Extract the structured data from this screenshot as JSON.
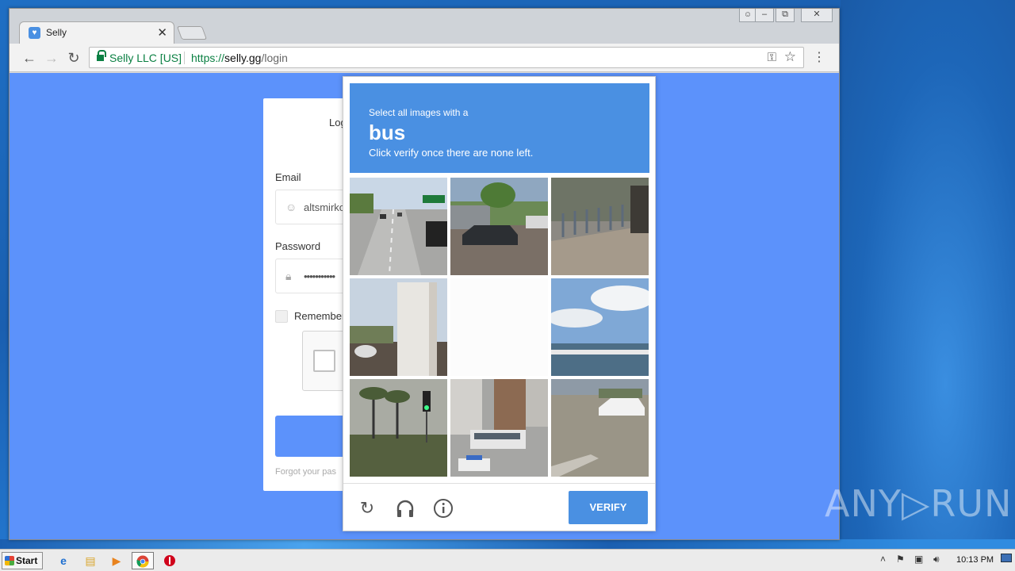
{
  "browser": {
    "tab_title": "Selly",
    "secure_label": "Selly LLC [US]",
    "url_scheme": "https://",
    "url_host": "selly.gg",
    "url_path": "/login"
  },
  "login": {
    "title": "Log",
    "email_label": "Email",
    "email_value": "altsmirko",
    "password_label": "Password",
    "password_value": "•••••••••••",
    "remember_label": "Remember",
    "forgot_text": "Forgot your pas"
  },
  "captcha": {
    "prompt": "Select all images with a",
    "target": "bus",
    "instruction": "Click verify once there are none left.",
    "verify_label": "VERIFY",
    "tiles": [
      "highway-cars",
      "street-parked-car",
      "bike-share-station",
      "building-roof",
      "blank-fading",
      "waterfront-boats",
      "traffic-light-palms",
      "city-bus-street",
      "parking-lot-car"
    ]
  },
  "watermark": "ANY▷RUN",
  "taskbar": {
    "start_label": "Start",
    "clock": "10:13 PM"
  },
  "colors": {
    "page_bg": "#5c92fb",
    "captcha_accent": "#4a90e2",
    "secure_green": "#0b8043"
  }
}
